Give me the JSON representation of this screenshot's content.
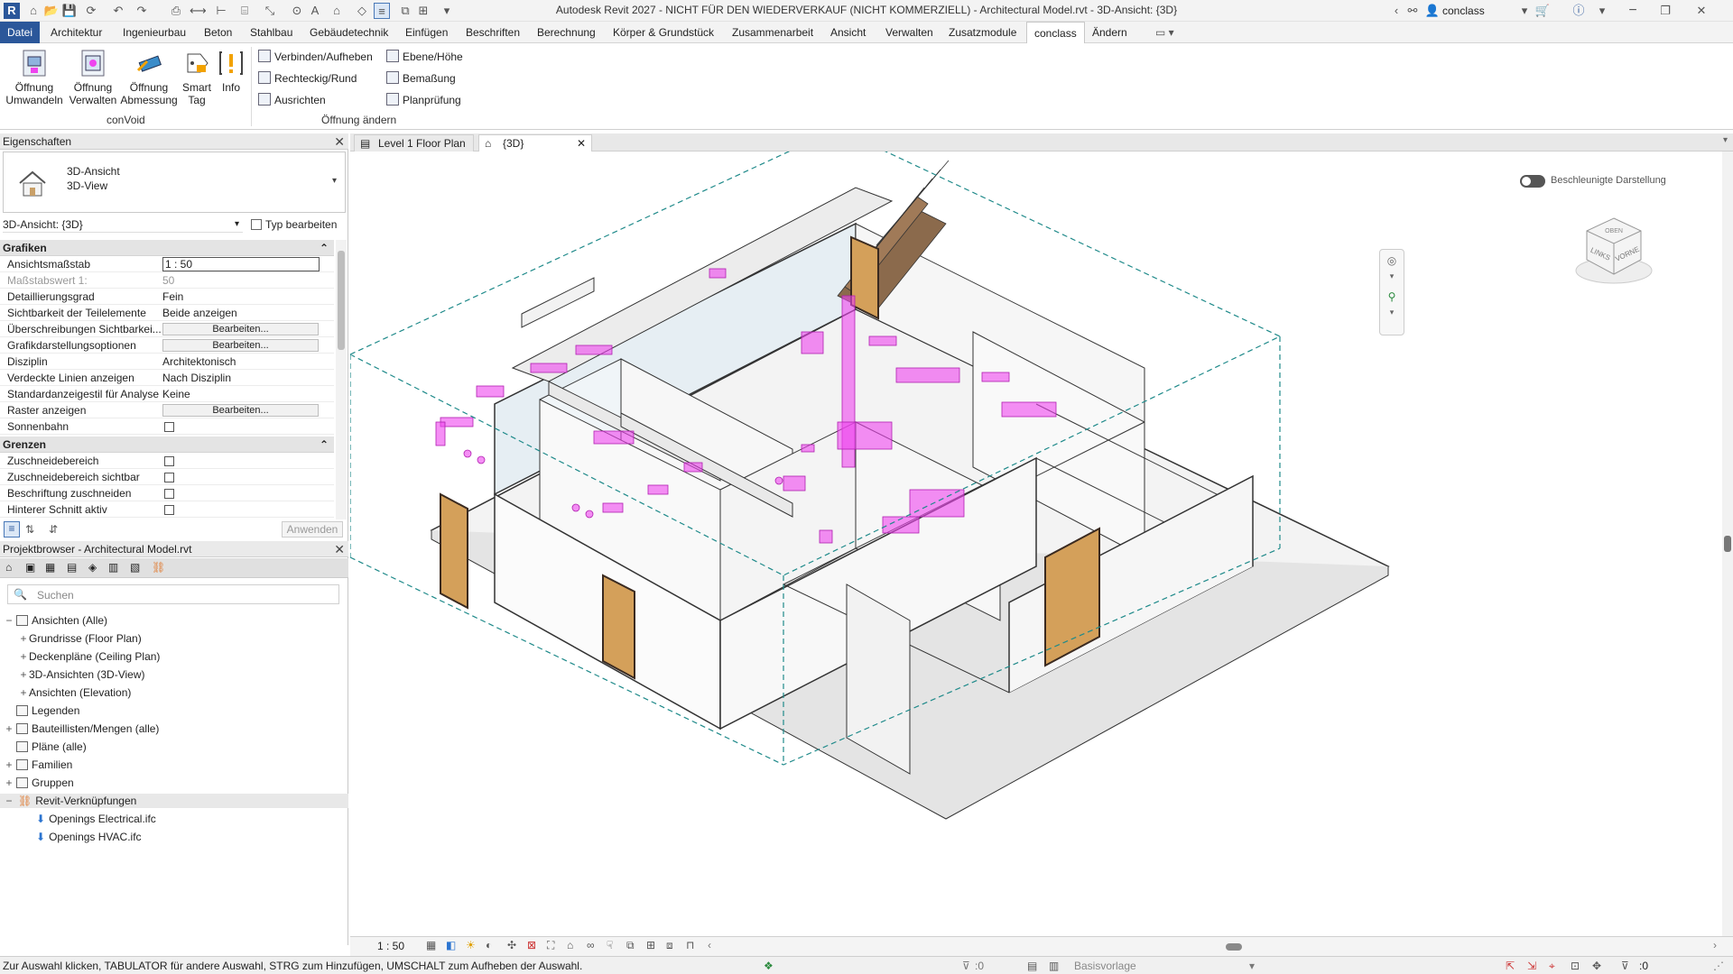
{
  "window": {
    "title": "Autodesk Revit 2027 - NICHT FÜR DEN WIEDERVERKAUF (NICHT KOMMERZIELL) - Architectural Model.rvt - 3D-Ansicht: {3D}",
    "user": "conclass",
    "app_letter": "R"
  },
  "menu": {
    "tabs": [
      "Datei",
      "Architektur",
      "Ingenieurbau",
      "Beton",
      "Stahlbau",
      "Gebäudetechnik",
      "Einfügen",
      "Beschriften",
      "Berechnung",
      "Körper & Grundstück",
      "Zusammenarbeit",
      "Ansicht",
      "Verwalten",
      "Zusatzmodule",
      "conclass",
      "Ändern"
    ],
    "active": "conclass"
  },
  "ribbon": {
    "convoid": {
      "panel_name": "conVoid",
      "buttons": [
        {
          "line1": "Öffnung",
          "line2": "Umwandeln"
        },
        {
          "line1": "Öffnung",
          "line2": "Verwalten"
        },
        {
          "line1": "Öffnung",
          "line2": "Abmessung"
        },
        {
          "line1": "Smart",
          "line2": "Tag"
        },
        {
          "line1": "Info",
          "line2": ""
        }
      ]
    },
    "oeffnung": {
      "panel_name": "Öffnung ändern",
      "left": [
        "Verbinden/Aufheben",
        "Rechteckig/Rund",
        "Ausrichten"
      ],
      "right": [
        "Ebene/Höhe",
        "Bemaßung",
        "Planprüfung"
      ]
    }
  },
  "properties": {
    "title": "Eigenschaften",
    "type_line1": "3D-Ansicht",
    "type_line2": "3D-View",
    "instance": "3D-Ansicht: {3D}",
    "edit_type": "Typ bearbeiten",
    "sections": {
      "grafiken": "Grafiken",
      "grenzen": "Grenzen"
    },
    "rows": [
      {
        "k": "Ansichtsmaßstab",
        "v": "1 : 50"
      },
      {
        "k": "Maßstabswert 1:",
        "v": "50"
      },
      {
        "k": "Detaillierungsgrad",
        "v": "Fein"
      },
      {
        "k": "Sichtbarkeit der Teilelemente",
        "v": "Beide anzeigen"
      },
      {
        "k": "Überschreibungen Sichtbarkei...",
        "v": "Bearbeiten..."
      },
      {
        "k": "Grafikdarstellungsoptionen",
        "v": "Bearbeiten..."
      },
      {
        "k": "Disziplin",
        "v": "Architektonisch"
      },
      {
        "k": "Verdeckte Linien anzeigen",
        "v": "Nach Disziplin"
      },
      {
        "k": "Standardanzeigestil für Analyse",
        "v": "Keine"
      },
      {
        "k": "Raster anzeigen",
        "v": "Bearbeiten..."
      },
      {
        "k": "Sonnenbahn",
        "v": ""
      }
    ],
    "grenzen_rows": [
      {
        "k": "Zuschneidebereich"
      },
      {
        "k": "Zuschneidebereich sichtbar"
      },
      {
        "k": "Beschriftung zuschneiden"
      },
      {
        "k": "Hinterer Schnitt aktiv"
      }
    ],
    "apply": "Anwenden"
  },
  "browser": {
    "title": "Projektbrowser - Architectural Model.rvt",
    "search_placeholder": "Suchen",
    "items": [
      {
        "label": "Ansichten (Alle)",
        "exp": "−"
      },
      {
        "label": "Grundrisse (Floor Plan)",
        "exp": "+"
      },
      {
        "label": "Deckenpläne (Ceiling Plan)",
        "exp": "+"
      },
      {
        "label": "3D-Ansichten (3D-View)",
        "exp": "+"
      },
      {
        "label": "Ansichten (Elevation)",
        "exp": "+"
      },
      {
        "label": "Legenden",
        "exp": ""
      },
      {
        "label": "Bauteillisten/Mengen (alle)",
        "exp": "+"
      },
      {
        "label": "Pläne (alle)",
        "exp": ""
      },
      {
        "label": "Familien",
        "exp": "+"
      },
      {
        "label": "Gruppen",
        "exp": "+"
      },
      {
        "label": "Revit-Verknüpfungen",
        "exp": "−"
      },
      {
        "label": "Openings Electrical.ifc",
        "exp": ""
      },
      {
        "label": "Openings HVAC.ifc",
        "exp": ""
      }
    ]
  },
  "views": {
    "tabs": [
      "Level 1 Floor Plan",
      "{3D}"
    ],
    "active": "{3D}",
    "accel_toggle": "Beschleunigte Darstellung",
    "viewcube": {
      "top": "OBEN",
      "left": "LINKS",
      "front": "VORNE"
    }
  },
  "viewbar": {
    "scale": "1 : 50"
  },
  "status": {
    "hint": "Zur Auswahl klicken, TABULATOR für andere Auswahl, STRG zum Hinzufügen, UMSCHALT zum Aufheben der Auswahl.",
    "workset": ":0",
    "design_option": "Basisvorlage",
    "filter_count": ":0"
  },
  "colors": {
    "accent": "#2b579a",
    "opening_magenta": "#ee44ee",
    "door_wood": "#d4a05a",
    "crop_dash": "#1f8a8a"
  }
}
